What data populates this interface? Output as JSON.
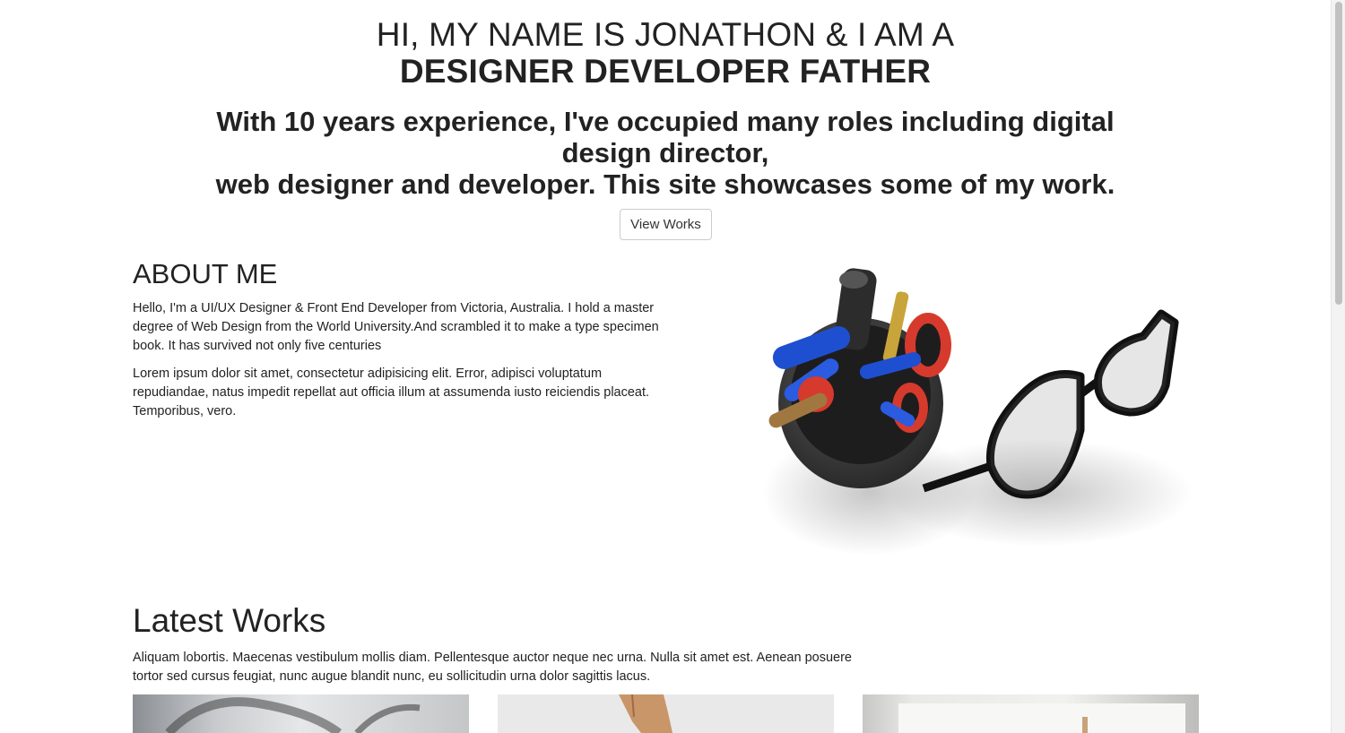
{
  "hero": {
    "title_line1": "HI, MY NAME IS JONATHON & I AM A",
    "title_line2": "DESIGNER DEVELOPER FATHER",
    "subtitle_line1": "With 10 years experience, I've occupied many roles including digital design director,",
    "subtitle_line2": "web designer and developer. This site showcases some of my work.",
    "button_label": "View Works"
  },
  "about": {
    "title": "ABOUT ME",
    "paragraph1": "Hello, I'm a UI/UX Designer & Front End Developer from Victoria, Australia. I hold a master degree of Web Design from the World University.And scrambled it to make a type specimen book. It has survived not only five centuries",
    "paragraph2": "Lorem ipsum dolor sit amet, consectetur adipisicing elit. Error, adipisci voluptatum repudiandae, natus impedit repellat aut officia illum at assumenda iusto reiciendis placeat. Temporibus, vero.",
    "image_icon": "pen-cup-and-glasses-photo"
  },
  "works": {
    "title": "Latest Works",
    "description": "Aliquam lobortis. Maecenas vestibulum mollis diam. Pellentesque auctor neque nec urna. Nulla sit amet est. Aenean posuere tortor sed cursus feugiat, nunc augue blandit nunc, eu sollicitudin urna dolor sagittis lacus."
  }
}
